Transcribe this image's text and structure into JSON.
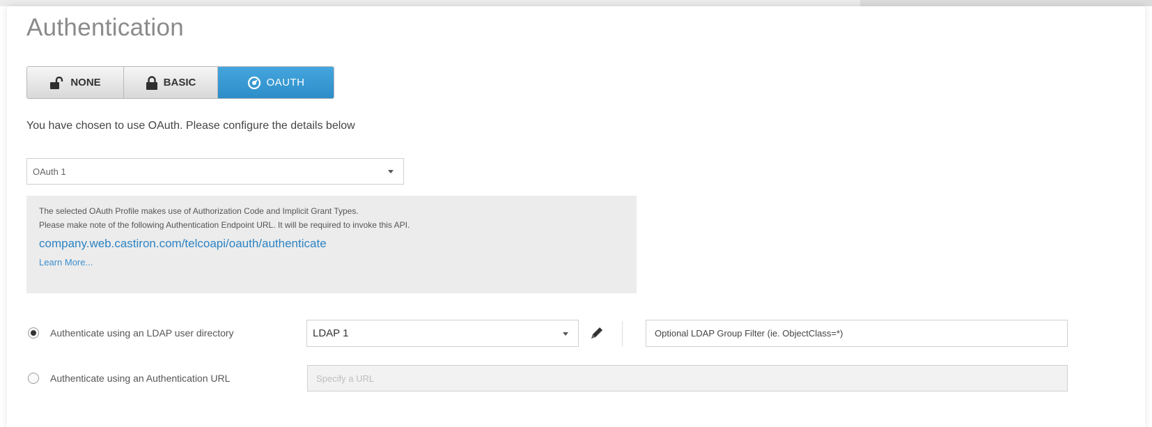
{
  "page": {
    "title": "Authentication"
  },
  "auth_modes": {
    "none_label": "NONE",
    "basic_label": "BASIC",
    "oauth_label": "OAUTH",
    "selected": "OAUTH"
  },
  "description": "You have chosen to use OAuth. Please configure the details below",
  "oauth_profile": {
    "selected_value": "OAuth 1"
  },
  "info_box": {
    "line1": "The selected OAuth Profile makes use of Authorization Code and Implicit Grant Types.",
    "line2": "Please make note of the following Authentication Endpoint URL. It will be required to invoke this API.",
    "endpoint_url": "company.web.castiron.com/telcoapi/oauth/authenticate",
    "learn_more": "Learn More..."
  },
  "ldap_option": {
    "label": "Authenticate using an LDAP user directory",
    "selected": true,
    "directory_value": "LDAP 1",
    "filter_placeholder": "Optional LDAP Group Filter (ie. ObjectClass=*)"
  },
  "url_option": {
    "label": "Authenticate using an Authentication URL",
    "selected": false,
    "url_placeholder": "Specify a URL"
  },
  "icons": {
    "none": "unlocked-padlock-icon",
    "basic": "padlock-icon",
    "oauth": "oauth-icon",
    "edit": "pencil-icon",
    "dropdown": "caret-down-icon"
  },
  "colors": {
    "accent": "#2d8dc8",
    "link": "#2b83c4",
    "info_bg": "#ececec",
    "title": "#8a8a8a"
  }
}
